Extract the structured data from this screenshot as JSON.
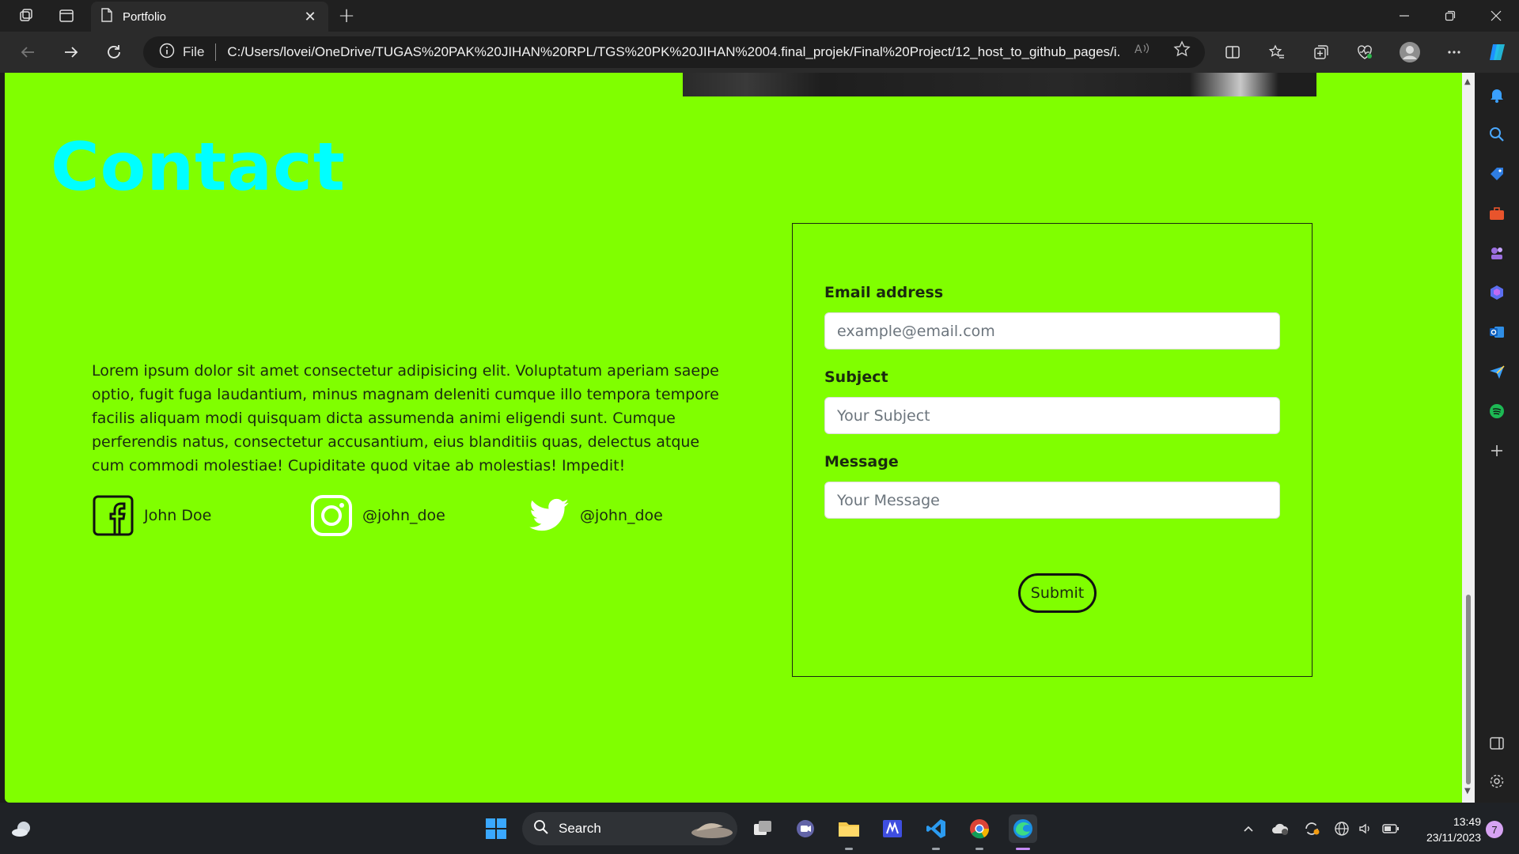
{
  "browser": {
    "tab_title": "Portfolio",
    "address_label": "File",
    "url": "C:/Users/lovei/OneDrive/TUGAS%20PAK%20JIHAN%20RPL/TGS%20PK%20JIHAN%2004.final_projek/Final%20Project/12_host_to_github_pages/i..."
  },
  "page": {
    "title": "Contact",
    "body_text": "Lorem ipsum dolor sit amet consectetur adipisicing elit. Voluptatum aperiam saepe optio, fugit fuga laudantium, minus magnam deleniti cumque illo tempora tempore facilis aliquam modi quisquam dicta assumenda animi eligendi sunt. Cumque perferendis natus, consectetur accusantium, eius blanditiis quas, delectus atque cum commodi molestiae! Cupiditate quod vitae ab molestias! Impedit!",
    "social": [
      {
        "icon": "facebook-icon",
        "label": "John Doe"
      },
      {
        "icon": "instagram-icon",
        "label": "@john_doe"
      },
      {
        "icon": "twitter-icon",
        "label": "@john_doe"
      }
    ],
    "form": {
      "email_label": "Email address",
      "email_placeholder": "example@email.com",
      "subject_label": "Subject",
      "subject_placeholder": "Your Subject",
      "message_label": "Message",
      "message_placeholder": "Your Message",
      "submit_label": "Submit"
    }
  },
  "taskbar": {
    "search_label": "Search",
    "time": "13:49",
    "date": "23/11/2023",
    "notification_count": "7"
  },
  "colors": {
    "page_background": "#80ff00",
    "title": "#00ffff",
    "browser_chrome": "#2b2b2b"
  }
}
